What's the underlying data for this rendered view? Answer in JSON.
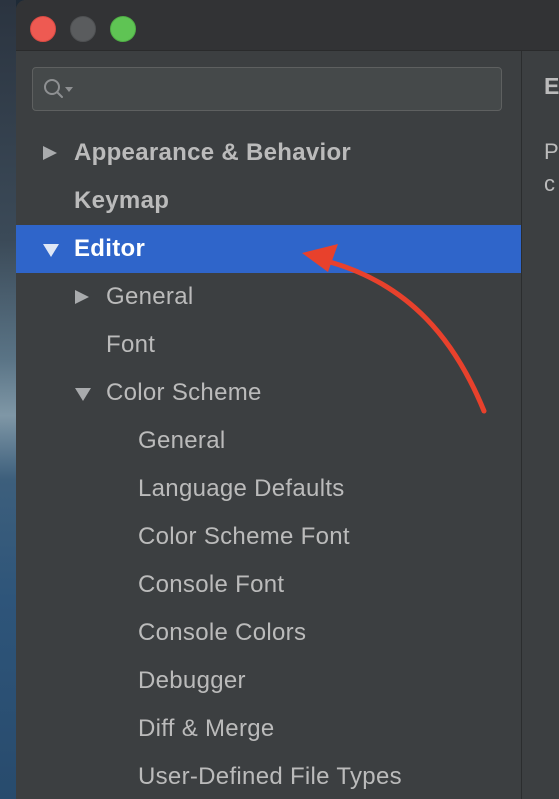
{
  "window": {
    "controls": [
      "close",
      "minimize",
      "maximize"
    ]
  },
  "search": {
    "placeholder": "",
    "icon": "search-icon"
  },
  "tree": {
    "items": [
      {
        "label": "Appearance & Behavior",
        "level": 0,
        "arrow": "right",
        "bold": true,
        "selected": false
      },
      {
        "label": "Keymap",
        "level": 0,
        "arrow": "none",
        "bold": true,
        "selected": false
      },
      {
        "label": "Editor",
        "level": 0,
        "arrow": "down",
        "bold": true,
        "selected": true
      },
      {
        "label": "General",
        "level": 1,
        "arrow": "right",
        "bold": false,
        "selected": false
      },
      {
        "label": "Font",
        "level": 1,
        "arrow": "none",
        "bold": false,
        "selected": false
      },
      {
        "label": "Color Scheme",
        "level": 1,
        "arrow": "down",
        "bold": false,
        "selected": false
      },
      {
        "label": "General",
        "level": 2,
        "arrow": "none",
        "bold": false,
        "selected": false
      },
      {
        "label": "Language Defaults",
        "level": 2,
        "arrow": "none",
        "bold": false,
        "selected": false
      },
      {
        "label": "Color Scheme Font",
        "level": 2,
        "arrow": "none",
        "bold": false,
        "selected": false
      },
      {
        "label": "Console Font",
        "level": 2,
        "arrow": "none",
        "bold": false,
        "selected": false
      },
      {
        "label": "Console Colors",
        "level": 2,
        "arrow": "none",
        "bold": false,
        "selected": false
      },
      {
        "label": "Debugger",
        "level": 2,
        "arrow": "none",
        "bold": false,
        "selected": false
      },
      {
        "label": "Diff & Merge",
        "level": 2,
        "arrow": "none",
        "bold": false,
        "selected": false
      },
      {
        "label": "User-Defined File Types",
        "level": 2,
        "arrow": "none",
        "bold": false,
        "selected": false
      }
    ]
  },
  "right_pane": {
    "title": "E",
    "line1": "P",
    "line2": "c"
  },
  "colors": {
    "selection": "#2f65ca",
    "annotation_arrow": "#e8412c",
    "panel_bg": "#3c3f41",
    "text": "#bbbbbb"
  }
}
